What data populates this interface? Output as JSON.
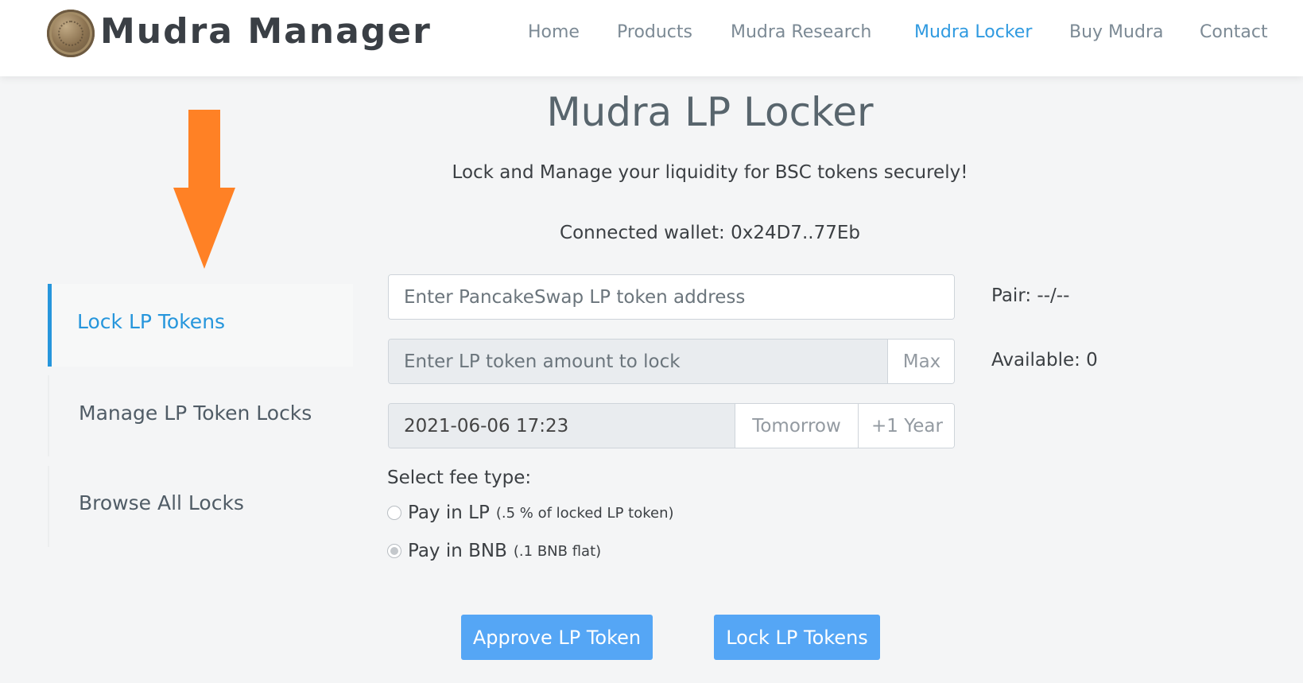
{
  "header": {
    "brand": "Mudra Manager",
    "nav": [
      {
        "label": "Home",
        "active": false
      },
      {
        "label": "Products",
        "active": false
      },
      {
        "label": "Mudra Research",
        "active": false
      },
      {
        "label": "Mudra Locker",
        "active": true
      },
      {
        "label": "Buy Mudra",
        "active": false
      },
      {
        "label": "Contact",
        "active": false
      }
    ]
  },
  "sidebar": {
    "items": [
      {
        "label": "Lock LP Tokens",
        "active": true
      },
      {
        "label": "Manage LP Token Locks",
        "active": false
      },
      {
        "label": "Browse All Locks",
        "active": false
      }
    ]
  },
  "main": {
    "title": "Mudra LP Locker",
    "subtitle": "Lock and Manage your liquidity for BSC tokens securely!",
    "wallet": "Connected wallet: 0x24D7..77Eb",
    "lp_address": {
      "placeholder": "Enter PancakeSwap LP token address",
      "value": ""
    },
    "pair_label": "Pair: --/--",
    "amount": {
      "placeholder": "Enter LP token amount to lock",
      "value": "",
      "max_label": "Max"
    },
    "available_label": "Available: 0",
    "date": {
      "value": "2021-06-06 17:23",
      "tomorrow_label": "Tomorrow",
      "year_label": "+1 Year"
    },
    "fee_label": "Select fee type:",
    "fee_options": [
      {
        "label": "Pay in LP",
        "note": "(.5 % of locked LP token)",
        "checked": false
      },
      {
        "label": "Pay in BNB",
        "note": "(.1 BNB flat)",
        "checked": true
      }
    ],
    "approve_button": "Approve LP Token",
    "lock_button": "Lock LP Tokens"
  },
  "colors": {
    "accent": "#2696dc",
    "button": "#55a6f5",
    "arrow": "#ff8125",
    "background": "#f4f5f6"
  },
  "icons": {
    "logo": "coin-logo-icon",
    "annotation": "arrow-down-icon"
  }
}
